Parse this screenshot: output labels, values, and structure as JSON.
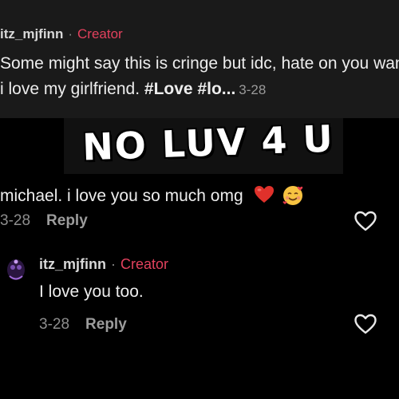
{
  "post": {
    "username": "itz_mjfinn",
    "separator": "·",
    "badge": "Creator",
    "caption": "Some might say this is cringe but idc, hate on you want, i love my girlfriend.",
    "hashtags": "#Love #lo...",
    "date": "3-28"
  },
  "overlay": {
    "title": "NO LUV 4 U"
  },
  "comment": {
    "text": "michael. i love you so much omg",
    "emoji": [
      "red-heart",
      "smiling-face-with-hearts"
    ],
    "date": "3-28",
    "reply_label": "Reply"
  },
  "reply": {
    "username": "itz_mjfinn",
    "separator": "·",
    "badge": "Creator",
    "text": "I love you too.",
    "date": "3-28",
    "reply_label": "Reply"
  },
  "colors": {
    "background": "#000000",
    "caption_background": "#1a1a1a",
    "creator_badge": "#e2415d"
  },
  "icons": [
    "heart-outline-icon",
    "avatar-image"
  ]
}
